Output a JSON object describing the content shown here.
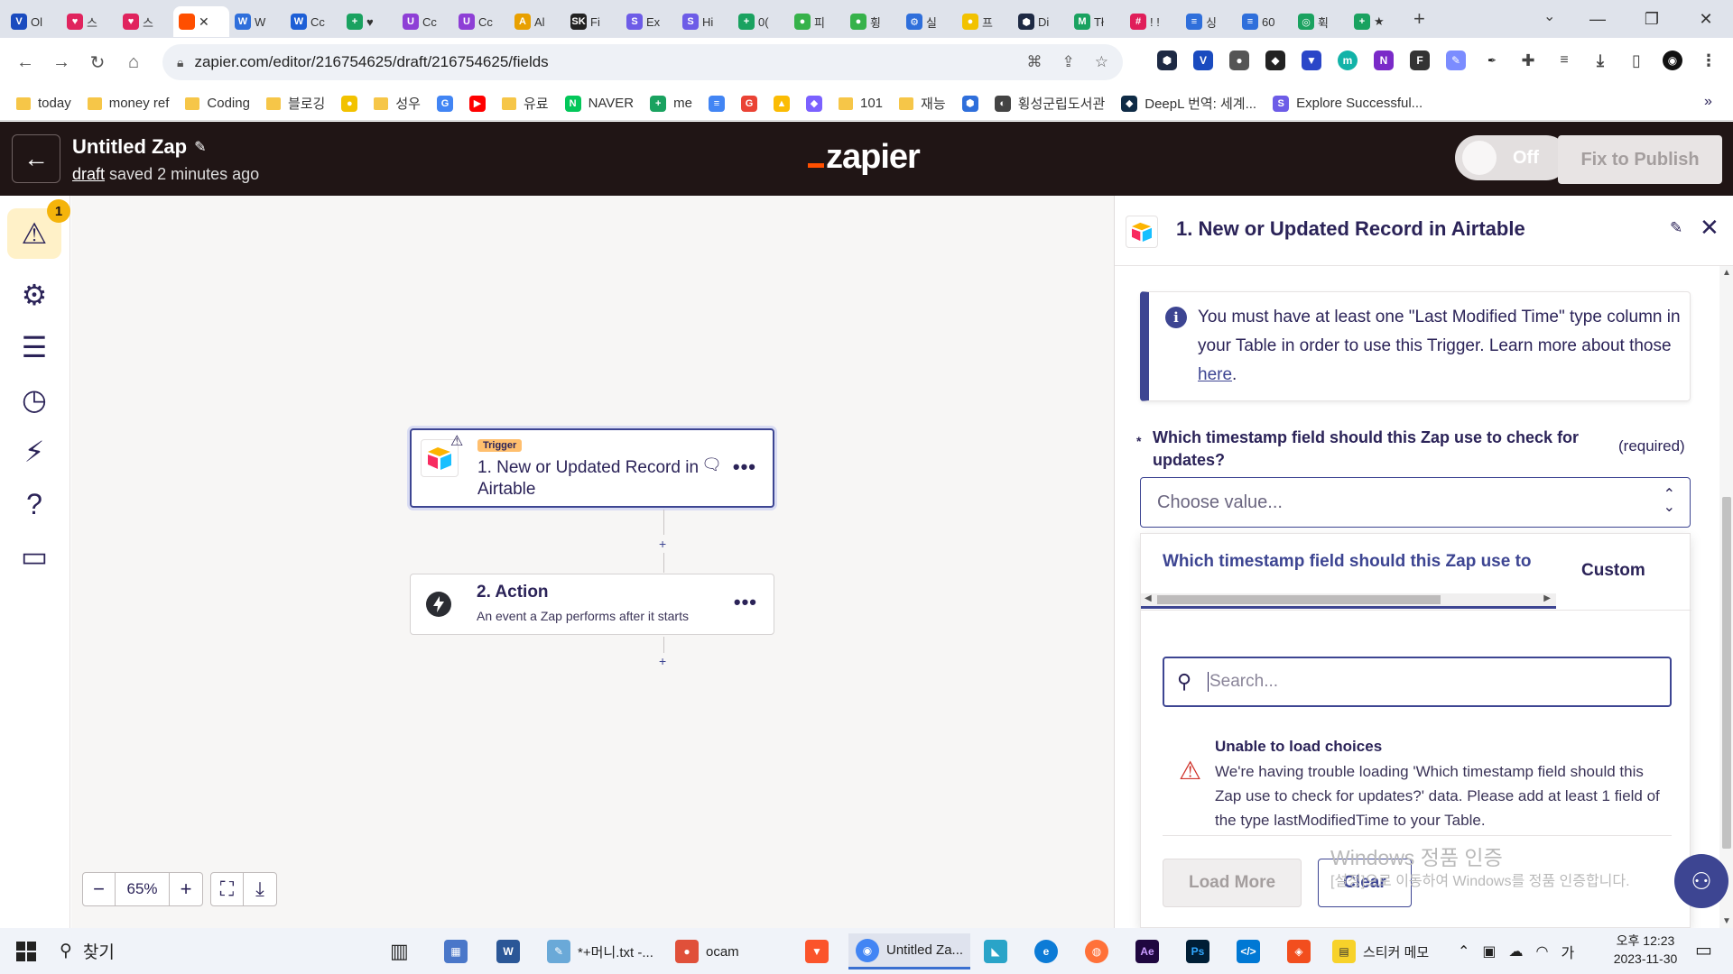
{
  "browser": {
    "tabs": [
      {
        "title": "Ol",
        "color": "#1a4bbf",
        "glyph": "V"
      },
      {
        "title": "스",
        "color": "#e0245e",
        "glyph": "♥"
      },
      {
        "title": "스",
        "color": "#e0245e",
        "glyph": "♥"
      },
      {
        "title": "",
        "color": "#ff4f00",
        "glyph": "",
        "active": true
      },
      {
        "title": "W",
        "color": "#2f6fdb",
        "glyph": "W"
      },
      {
        "title": "Cc",
        "color": "#1d5fd6",
        "glyph": "W"
      },
      {
        "title": "♥",
        "color": "#1aa260",
        "glyph": "+"
      },
      {
        "title": "Cc",
        "color": "#8e3fd6",
        "glyph": "U"
      },
      {
        "title": "Cc",
        "color": "#8e3fd6",
        "glyph": "U"
      },
      {
        "title": "Al",
        "color": "#e8a000",
        "glyph": "A"
      },
      {
        "title": "Fi",
        "color": "#222222",
        "glyph": "SK"
      },
      {
        "title": "Ex",
        "color": "#6d5ce7",
        "glyph": "S"
      },
      {
        "title": "Hi",
        "color": "#6d5ce7",
        "glyph": "S"
      },
      {
        "title": "0(",
        "color": "#1aa260",
        "glyph": "+"
      },
      {
        "title": "피",
        "color": "#36b24a",
        "glyph": "●"
      },
      {
        "title": "휭",
        "color": "#36b24a",
        "glyph": "●"
      },
      {
        "title": "실",
        "color": "#2f6fdb",
        "glyph": "⚙"
      },
      {
        "title": "프",
        "color": "#f2c200",
        "glyph": "●"
      },
      {
        "title": "Di",
        "color": "#1e2a44",
        "glyph": "⬢"
      },
      {
        "title": "Tł",
        "color": "#1aa260",
        "glyph": "M"
      },
      {
        "title": "! !",
        "color": "#e01e5a",
        "glyph": "#"
      },
      {
        "title": "싱",
        "color": "#2f6fdb",
        "glyph": "≡"
      },
      {
        "title": "60",
        "color": "#2f6fdb",
        "glyph": "≡"
      },
      {
        "title": "휙",
        "color": "#1aa260",
        "glyph": "◎"
      },
      {
        "title": "★",
        "color": "#1aa260",
        "glyph": "+"
      }
    ],
    "url": "zapier.com/editor/216754625/draft/216754625/fields"
  },
  "bookmarks": [
    {
      "label": "today",
      "type": "folder"
    },
    {
      "label": "money ref",
      "type": "folder"
    },
    {
      "label": "Coding",
      "type": "folder"
    },
    {
      "label": "블로깅",
      "type": "folder"
    },
    {
      "label": "",
      "type": "icon",
      "color": "#f2c200",
      "glyph": "●"
    },
    {
      "label": "성우",
      "type": "folder"
    },
    {
      "label": "",
      "type": "icon",
      "color": "#4285f4",
      "glyph": "G"
    },
    {
      "label": "",
      "type": "icon",
      "color": "#ff0000",
      "glyph": "▶"
    },
    {
      "label": "유료",
      "type": "folder"
    },
    {
      "label": "NAVER",
      "type": "icon",
      "color": "#03c75a",
      "glyph": "N"
    },
    {
      "label": "me",
      "type": "icon",
      "color": "#1aa260",
      "glyph": "+"
    },
    {
      "label": "",
      "type": "icon",
      "color": "#4285f4",
      "glyph": "≡"
    },
    {
      "label": "",
      "type": "icon",
      "color": "#ea4335",
      "glyph": "G"
    },
    {
      "label": "",
      "type": "icon",
      "color": "#fbbc04",
      "glyph": "▲"
    },
    {
      "label": "",
      "type": "icon",
      "color": "#7b61ff",
      "glyph": "◆"
    },
    {
      "label": "101",
      "type": "folder"
    },
    {
      "label": "재능",
      "type": "folder"
    },
    {
      "label": "",
      "type": "icon",
      "color": "#2f6fdb",
      "glyph": "⬢"
    },
    {
      "label": "횡성군립도서관",
      "type": "icon",
      "color": "#444444",
      "glyph": "◐"
    },
    {
      "label": "DeepL 번역: 세계...",
      "type": "icon",
      "color": "#0f2b46",
      "glyph": "◆"
    },
    {
      "label": "Explore Successful...",
      "type": "icon",
      "color": "#6d5ce7",
      "glyph": "S"
    }
  ],
  "header": {
    "zap_title": "Untitled Zap",
    "draft_link": "draft",
    "saved_text": "saved 2 minutes ago",
    "logo_text": "zapier",
    "toggle_label": "Off",
    "publish_label": "Fix to Publish"
  },
  "sidebar": {
    "alert_count": "1"
  },
  "canvas": {
    "trigger": {
      "tag": "Trigger",
      "title": "1. New or Updated Record in Airtable"
    },
    "action": {
      "title": "2. Action",
      "subtitle": "An event a Zap performs after it starts"
    },
    "zoom": "65%"
  },
  "panel": {
    "title": "1. New or Updated Record in Airtable",
    "info_text": "You must have at least one \"Last Modified Time\" type column in your Table in order to use this Trigger. Learn more about those ",
    "info_link": "here",
    "info_end": ".",
    "field_label": "Which timestamp field should this Zap use to check for updates?",
    "required_label": "(required)",
    "select_placeholder": "Choose value...",
    "dropdown": {
      "tab_active": "Which timestamp field should this Zap use to",
      "tab_custom": "Custom",
      "search_placeholder": "Search...",
      "error_title": "Unable to load choices",
      "error_text": "We're having trouble loading 'Which timestamp field should this Zap use to check for updates?' data. Please add at least 1 field of the type lastModifiedTime to your Table.",
      "load_more": "Load More",
      "clear": "Clear"
    },
    "watermark_title": "Windows 정품 인증",
    "watermark_sub": "[설정]으로 이동하여 Windows를 정품 인증합니다."
  },
  "taskbar": {
    "search_label": "찾기",
    "items": [
      {
        "label": "*+머니.txt -...",
        "color": "#6aa9d8"
      },
      {
        "label": "ocam",
        "color": "#e0503a"
      },
      {
        "label": "Untitled Za...",
        "color": "#4285f4"
      },
      {
        "label": "스티커 메모",
        "color": "#f7d22a"
      }
    ],
    "time": "오후 12:23",
    "date": "2023-11-30",
    "ime": "가"
  }
}
